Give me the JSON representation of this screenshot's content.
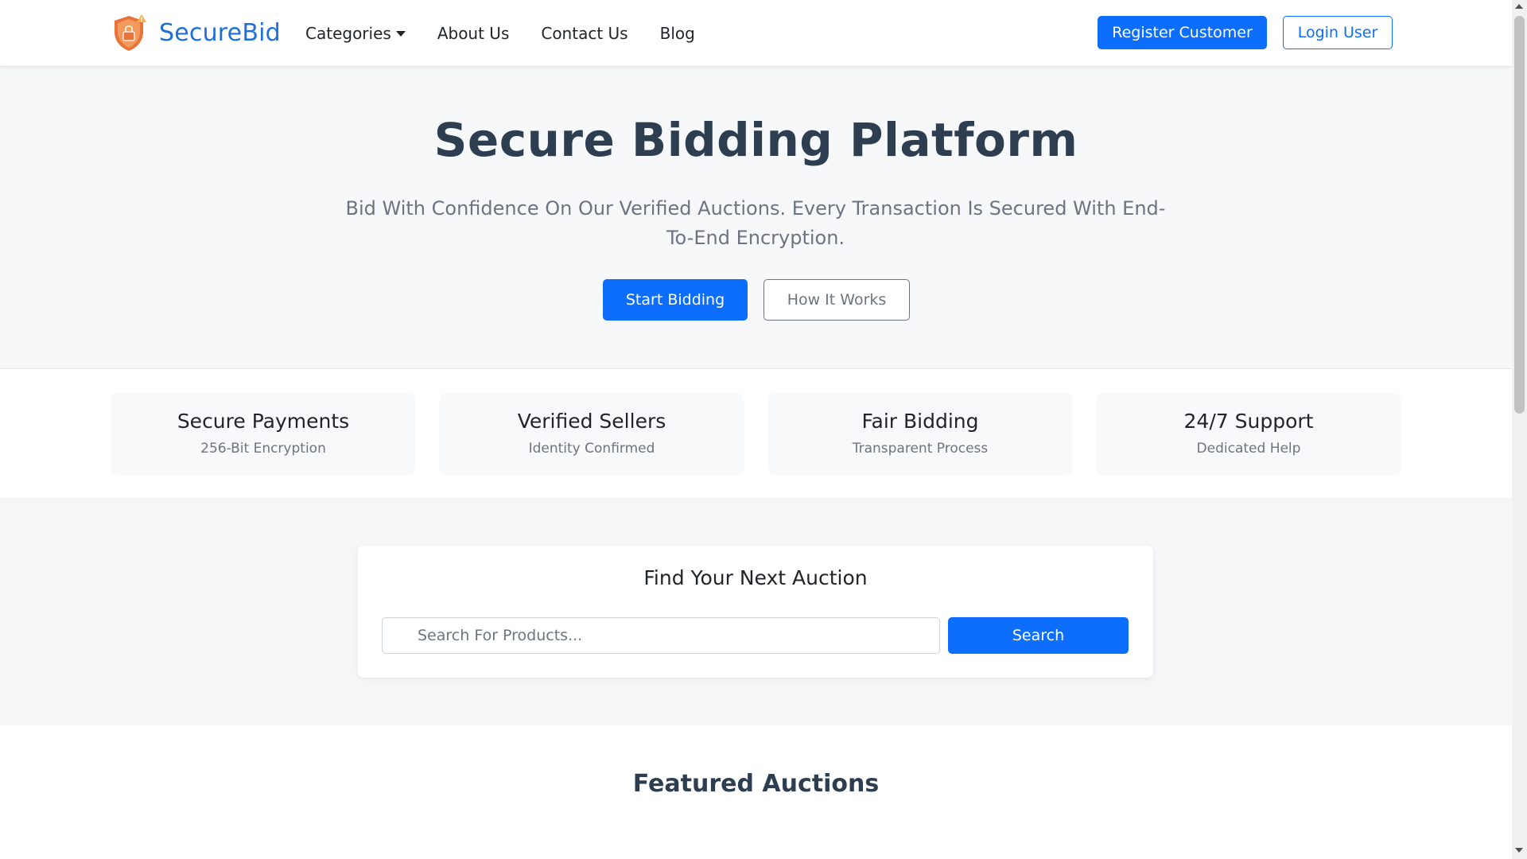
{
  "header": {
    "brand_name": "SecureBid",
    "brand_icon": "shield-lock-icon",
    "nav": {
      "categories": "Categories",
      "about": "About Us",
      "contact": "Contact Us",
      "blog": "Blog"
    },
    "register_label": "Register Customer",
    "login_label": "Login User"
  },
  "hero": {
    "title": "Secure Bidding Platform",
    "subtitle": "Bid With Confidence On Our Verified Auctions. Every Transaction Is Secured With End-To-End Encryption.",
    "start_label": "Start Bidding",
    "how_label": "How It Works"
  },
  "features": [
    {
      "title": "Secure Payments",
      "desc": "256-Bit Encryption"
    },
    {
      "title": "Verified Sellers",
      "desc": "Identity Confirmed"
    },
    {
      "title": "Fair Bidding",
      "desc": "Transparent Process"
    },
    {
      "title": "24/7 Support",
      "desc": "Dedicated Help"
    }
  ],
  "search": {
    "title": "Find Your Next Auction",
    "placeholder": "Search For Products...",
    "button_label": "Search"
  },
  "featured": {
    "title": "Featured Auctions"
  },
  "colors": {
    "primary": "#0d6efd",
    "brand": "#1f6fd8",
    "heading": "#2c3e50",
    "muted": "#6c757d"
  }
}
